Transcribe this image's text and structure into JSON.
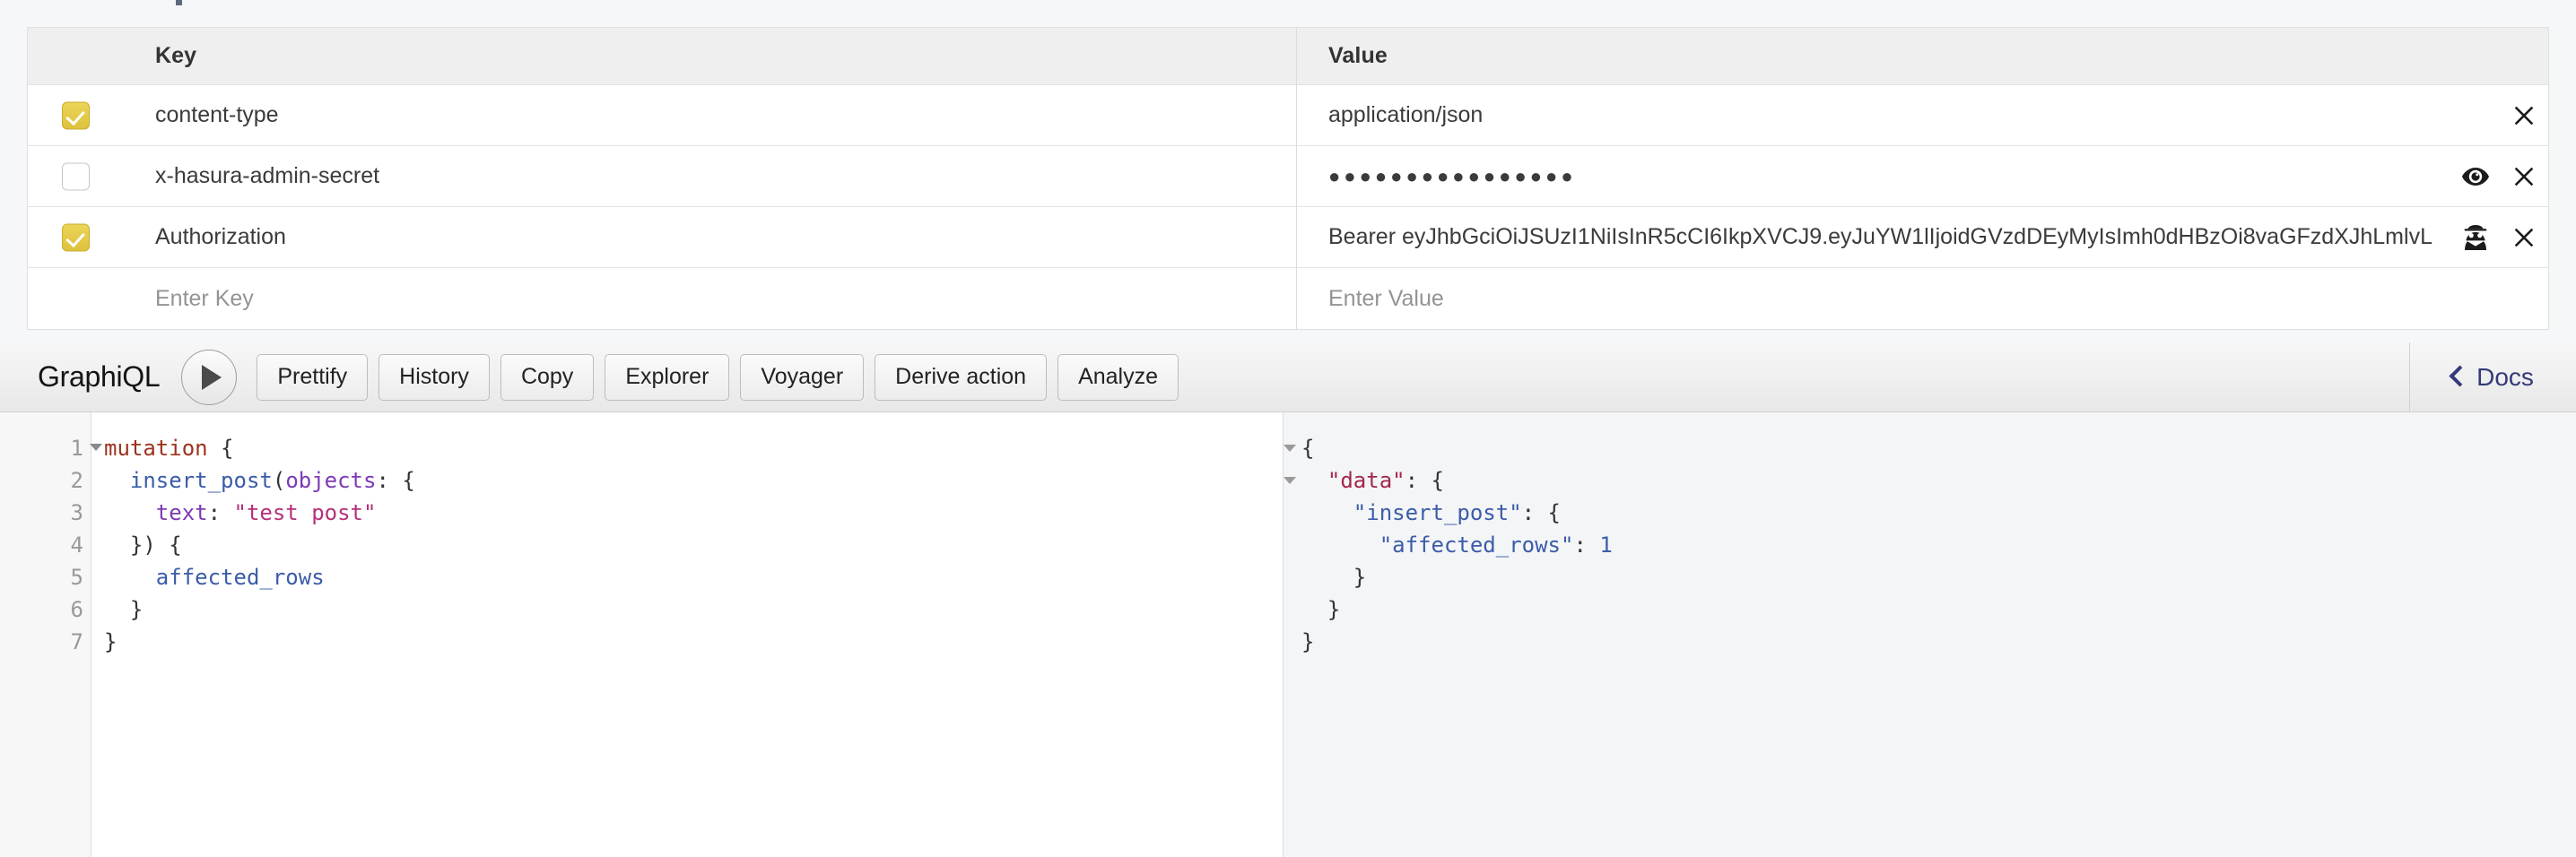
{
  "headers_table": {
    "columns": {
      "key": "Key",
      "value": "Value"
    },
    "rows": [
      {
        "checked": true,
        "key": "content-type",
        "value": "application/json",
        "masked": false,
        "actions": [
          "close-icon"
        ]
      },
      {
        "checked": false,
        "key": "x-hasura-admin-secret",
        "value": "●●●●●●●●●●●●●●●●",
        "masked": true,
        "actions": [
          "eye-icon",
          "close-icon"
        ]
      },
      {
        "checked": true,
        "key": "Authorization",
        "value": "Bearer eyJhbGciOiJSUzI1NiIsInR5cCI6IkpXVCJ9.eyJuYW1lIjoidGVzdDEyMyIsImh0dHBzOi8vaGFzdXJhLmlvL",
        "masked": false,
        "actions": [
          "spy-icon",
          "close-icon"
        ]
      }
    ],
    "new_row": {
      "key_placeholder": "Enter Key",
      "value_placeholder": "Enter Value"
    }
  },
  "graphiql": {
    "logo": "GraphiQL",
    "execute_label": "execute-query",
    "buttons": [
      "Prettify",
      "History",
      "Copy",
      "Explorer",
      "Voyager",
      "Derive action",
      "Analyze"
    ],
    "docs_label": "Docs"
  },
  "editor": {
    "line_numbers": [
      "1",
      "2",
      "3",
      "4",
      "5",
      "6",
      "7"
    ],
    "fold_on_line": 1,
    "lines": [
      [
        {
          "t": "mutation",
          "c": "tok-kw"
        },
        {
          "t": " {",
          "c": "tok-punc"
        }
      ],
      [
        {
          "t": "  ",
          "c": "tok-punc"
        },
        {
          "t": "insert_post",
          "c": "tok-field"
        },
        {
          "t": "(",
          "c": "tok-punc"
        },
        {
          "t": "objects",
          "c": "tok-arg"
        },
        {
          "t": ": {",
          "c": "tok-punc"
        }
      ],
      [
        {
          "t": "    ",
          "c": "tok-punc"
        },
        {
          "t": "text",
          "c": "tok-arg"
        },
        {
          "t": ": ",
          "c": "tok-punc"
        },
        {
          "t": "\"test post\"",
          "c": "tok-str"
        }
      ],
      [
        {
          "t": "  }) {",
          "c": "tok-punc"
        }
      ],
      [
        {
          "t": "    ",
          "c": "tok-punc"
        },
        {
          "t": "affected_rows",
          "c": "tok-field"
        }
      ],
      [
        {
          "t": "  }",
          "c": "tok-punc"
        }
      ],
      [
        {
          "t": "}",
          "c": "tok-punc"
        }
      ]
    ]
  },
  "result": {
    "fold_lines": [
      1,
      2
    ],
    "lines": [
      [
        {
          "t": "{",
          "c": "rtok-punc"
        }
      ],
      [
        {
          "t": "  ",
          "c": "rtok-punc"
        },
        {
          "t": "\"data\"",
          "c": "rtok-key"
        },
        {
          "t": ": {",
          "c": "rtok-punc"
        }
      ],
      [
        {
          "t": "    ",
          "c": "rtok-punc"
        },
        {
          "t": "\"insert_post\"",
          "c": "rtok-key2"
        },
        {
          "t": ": {",
          "c": "rtok-punc"
        }
      ],
      [
        {
          "t": "      ",
          "c": "rtok-punc"
        },
        {
          "t": "\"affected_rows\"",
          "c": "rtok-key2"
        },
        {
          "t": ": ",
          "c": "rtok-punc"
        },
        {
          "t": "1",
          "c": "rtok-num"
        }
      ],
      [
        {
          "t": "    }",
          "c": "rtok-punc"
        }
      ],
      [
        {
          "t": "  }",
          "c": "rtok-punc"
        }
      ],
      [
        {
          "t": "}",
          "c": "rtok-punc"
        }
      ]
    ]
  }
}
